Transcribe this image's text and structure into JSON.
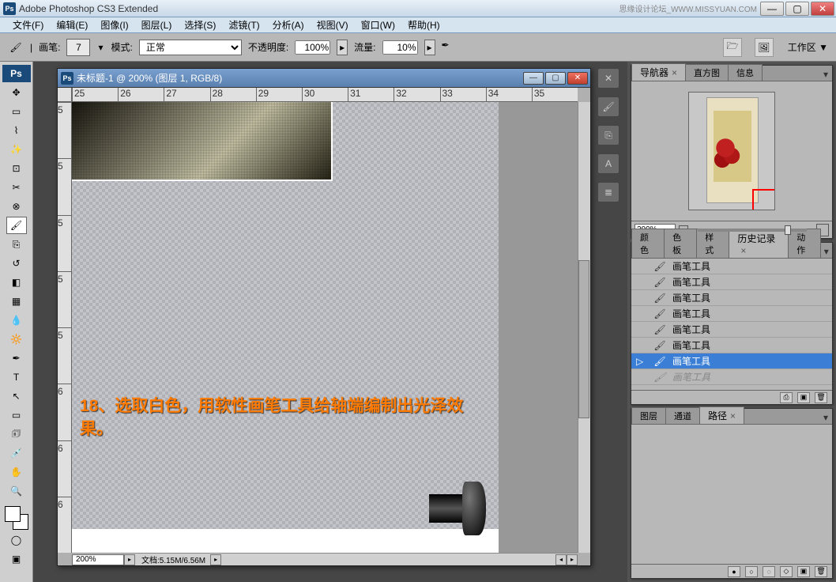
{
  "app": {
    "title": "Adobe Photoshop CS3 Extended",
    "watermark": "思缘设计论坛_WWW.MISSYUAN.COM"
  },
  "menu": [
    "文件(F)",
    "编辑(E)",
    "图像(I)",
    "图层(L)",
    "选择(S)",
    "滤镜(T)",
    "分析(A)",
    "视图(V)",
    "窗口(W)",
    "帮助(H)"
  ],
  "options": {
    "brush_label": "画笔:",
    "brush_size": "7",
    "mode_label": "模式:",
    "mode_value": "正常",
    "opacity_label": "不透明度:",
    "opacity_value": "100%",
    "flow_label": "流量:",
    "flow_value": "10%",
    "workspace_label": "工作区 ▼"
  },
  "document": {
    "title": "未标题-1 @ 200% (图层 1, RGB/8)",
    "zoom": "200%",
    "info": "文档:5.15M/6.56M",
    "ruler_h": [
      "25",
      "26",
      "27",
      "28",
      "29",
      "30",
      "31",
      "32",
      "33",
      "34",
      "35"
    ],
    "ruler_v": [
      "5",
      "5",
      "5",
      "5",
      "5",
      "6",
      "6",
      "6"
    ],
    "caption": "18、选取白色，用软性画笔工具给轴端编制出光泽效果。"
  },
  "panels": {
    "navigator": {
      "tabs": [
        "导航器",
        "直方图",
        "信息"
      ],
      "active": 0,
      "zoom": "200%"
    },
    "history": {
      "tabs": [
        "颜色",
        "色板",
        "样式",
        "历史记录",
        "动作"
      ],
      "active": 3,
      "items": [
        {
          "label": "画笔工具",
          "selected": false
        },
        {
          "label": "画笔工具",
          "selected": false
        },
        {
          "label": "画笔工具",
          "selected": false
        },
        {
          "label": "画笔工具",
          "selected": false
        },
        {
          "label": "画笔工具",
          "selected": false
        },
        {
          "label": "画笔工具",
          "selected": false
        },
        {
          "label": "画笔工具",
          "selected": true
        },
        {
          "label": "画笔工具",
          "selected": false,
          "dimmed": true
        }
      ]
    },
    "layers": {
      "tabs": [
        "图层",
        "通道",
        "路径"
      ],
      "active": 2
    }
  }
}
